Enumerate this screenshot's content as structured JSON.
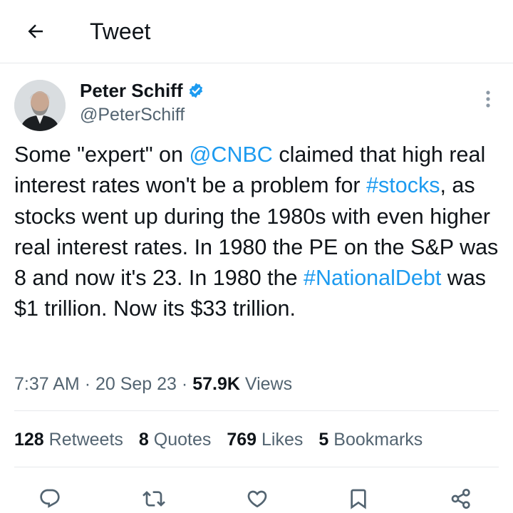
{
  "header": {
    "title": "Tweet"
  },
  "author": {
    "name": "Peter Schiff",
    "handle": "@PeterSchiff"
  },
  "tweet": {
    "segments": [
      {
        "text": "Some \"expert\" on "
      },
      {
        "text": "@CNBC",
        "link": true
      },
      {
        "text": " claimed that high real interest rates won't be a problem for "
      },
      {
        "text": "#stocks",
        "link": true
      },
      {
        "text": ", as stocks went up during the 1980s with even higher real interest rates. In 1980 the PE on the S&P was 8 and now it's 23. In 1980 the "
      },
      {
        "text": "#NationalDebt",
        "link": true
      },
      {
        "text": " was $1 trillion. Now its $33 trillion."
      }
    ]
  },
  "meta": {
    "time": "7:37 AM",
    "date": "20 Sep 23",
    "views_count": "57.9K",
    "views_label": "Views",
    "separator": "·"
  },
  "stats": {
    "retweets": {
      "count": "128",
      "label": "Retweets"
    },
    "quotes": {
      "count": "8",
      "label": "Quotes"
    },
    "likes": {
      "count": "769",
      "label": "Likes"
    },
    "bookmarks": {
      "count": "5",
      "label": "Bookmarks"
    }
  },
  "icons": {
    "back": "arrow-left-icon",
    "verified": "verified-badge-icon",
    "more": "more-vertical-icon",
    "reply": "reply-icon",
    "retweet": "retweet-icon",
    "like": "heart-icon",
    "bookmark": "bookmark-icon",
    "share": "share-icon"
  },
  "colors": {
    "link": "#1d9bf0",
    "verified": "#1d9bf0",
    "secondary_text": "#536471",
    "primary_text": "#0f1419",
    "divider": "#e6e9eb"
  }
}
